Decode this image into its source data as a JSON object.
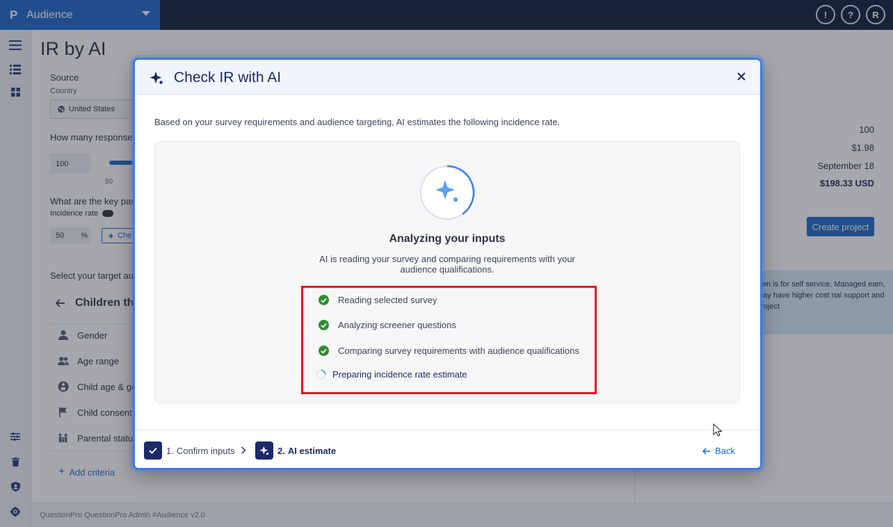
{
  "topbar": {
    "app_logo": "P",
    "app_name": "Audience",
    "icons": [
      {
        "name": "feedback-icon",
        "glyph": "!"
      },
      {
        "name": "help-icon",
        "glyph": "?"
      },
      {
        "name": "user-avatar",
        "glyph": "R"
      }
    ]
  },
  "page": {
    "title": "IR by AI",
    "source_label": "Source",
    "country_label": "Country",
    "country_value": "United States",
    "responses_question": "How many responses",
    "responses_value": "100",
    "slider_min_label": "50",
    "key_params_question": "What are the key par",
    "incidence_label": "Incidence rate",
    "incidence_value": "50",
    "incidence_unit": "%",
    "check_button_label": "Che",
    "target_audience_label": "Select your target au",
    "audience_name": "Children th",
    "criteria": [
      "Gender",
      "Age range",
      "Child age & ge",
      "Child consent",
      "Parental statu"
    ],
    "add_criteria_label": "Add criteria",
    "summary_values": [
      "100",
      "$1.98",
      "September 18",
      "$198.33 USD"
    ],
    "create_project_label": "Create project",
    "info_text": "own is for self service. Managed eam, may have higher cost nal support and project",
    "footer_text": "QuestionPro QuestionPro Admin  #Audience v2.0"
  },
  "modal": {
    "title": "Check IR with AI",
    "description": "Based on your survey requirements and audience targeting, AI estimates the following incidence rate.",
    "analyze_title": "Analyzing your inputs",
    "analyze_subtitle": "AI is reading your survey and comparing requirements with your audience qualifications.",
    "steps": [
      {
        "label": "Reading selected survey",
        "status": "done"
      },
      {
        "label": "Analyzing screener questions",
        "status": "done"
      },
      {
        "label": "Comparing survey requirements with audience qualifications",
        "status": "done"
      },
      {
        "label": "Preparing incidence rate estimate",
        "status": "in-progress"
      }
    ],
    "wizard": [
      {
        "number": "1.",
        "label": "Confirm inputs",
        "state": "completed"
      },
      {
        "number": "2.",
        "label": "AI estimate",
        "state": "current"
      }
    ],
    "back_label": "Back"
  },
  "colors": {
    "brand_blue": "#1b66c9",
    "navy": "#0b1a3a",
    "success_green": "#2e8b2e",
    "highlight_red": "#e0101c",
    "modal_border": "#3c7be8"
  }
}
